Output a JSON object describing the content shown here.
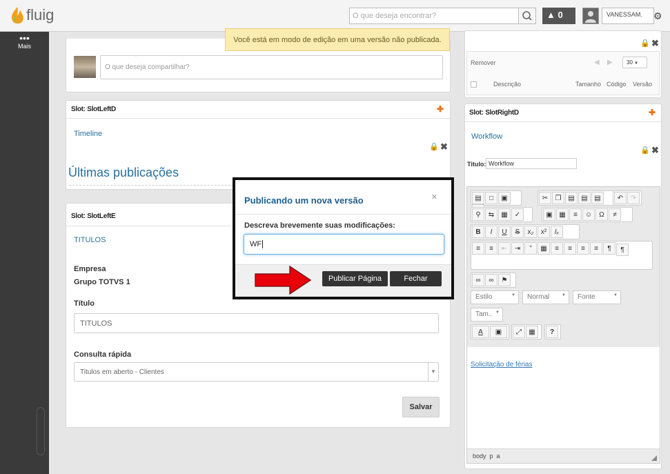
{
  "header": {
    "brand": "fluig",
    "search_placeholder": "O que deseja encontrar?",
    "notifications_count": "0",
    "user_name": "VANESSAM."
  },
  "sidebar": {
    "more_label": "Mais"
  },
  "banner": {
    "text": "Você está em modo de edição em uma versão não publicada."
  },
  "composer": {
    "placeholder": "O que deseja compartilhar?"
  },
  "left_slot_d": {
    "slot_label": "Slot: SlotLeftD",
    "widget_title": "Timeline",
    "heading": "Últimas publicações"
  },
  "left_slot_e": {
    "slot_label": "Slot: SlotLeftE",
    "widget_title": "TITULOS",
    "company_label": "Empresa",
    "company_value": "Grupo TOTVS 1",
    "title_label": "Título",
    "title_value": "TITULOS",
    "quick_label": "Consulta rápida",
    "quick_value": "Titulos em aberto - Clientes",
    "save_button": "Salvar"
  },
  "right_top": {
    "remove_label": "Remover",
    "page_size": "30",
    "columns": [
      "Descrição",
      "Tamanho",
      "Código",
      "Versão"
    ]
  },
  "right_slot_d": {
    "slot_label": "Slot: SlotRightD",
    "widget_title": "Workflow",
    "title_field_label": "Titulo:",
    "title_field_value": "Workflow",
    "editor": {
      "style_combo": "Estilo",
      "format_combo": "Normal",
      "font_combo": "Fonte",
      "size_combo": "Tam..",
      "link_text": "Solicitação de férias",
      "path_bar": "body  p  a"
    }
  },
  "modal": {
    "title": "Publicando um nova versão",
    "prompt": "Descreva brevemente suas modificações:",
    "input_value": "WF",
    "publish_button": "Publicar Página",
    "close_button": "Fechar",
    "arrow_color": "#e8000b"
  },
  "colors": {
    "sidebar": "#3a3a3a",
    "link": "#2a6f9a",
    "banner": "#fbecb2"
  }
}
